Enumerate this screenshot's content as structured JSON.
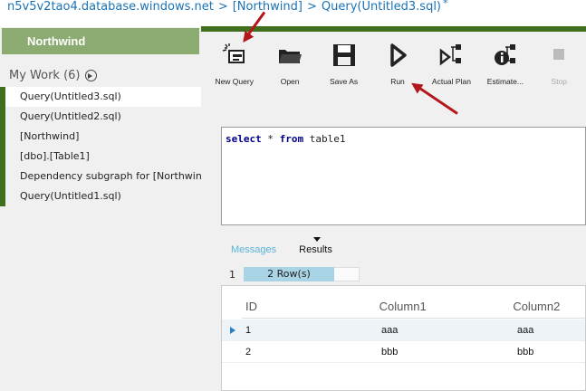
{
  "breadcrumb": {
    "server": "n5v5v2tao4.database.windows.net",
    "sep1": ">",
    "database": "[Northwind]",
    "sep2": ">",
    "query": "Query(Untitled3.sql)",
    "modified": "*"
  },
  "sidebar": {
    "header": "Northwind",
    "mywork": "My Work (6)",
    "items": [
      {
        "label": "Query(Untitled3.sql)"
      },
      {
        "label": "Query(Untitled2.sql)"
      },
      {
        "label": "[Northwind]"
      },
      {
        "label": "[dbo].[Table1]"
      },
      {
        "label": "Dependency subgraph for [Northwind]"
      },
      {
        "label": "Query(Untitled1.sql)"
      }
    ]
  },
  "toolbar": {
    "new_query": "New Query",
    "open": "Open",
    "save_as": "Save As",
    "run": "Run",
    "actual_plan": "Actual Plan",
    "estimate": "Estimate...",
    "stop": "Stop"
  },
  "editor": {
    "kw1": "select",
    "star": "*",
    "kw2": "from",
    "table": "table1"
  },
  "tabs": {
    "messages": "Messages",
    "results": "Results"
  },
  "rowstrip": {
    "page": "1",
    "count": "2 Row(s)"
  },
  "grid": {
    "columns": [
      "ID",
      "Column1",
      "Column2"
    ],
    "rows": [
      [
        "1",
        "aaa",
        "aaa"
      ],
      [
        "2",
        "bbb",
        "bbb"
      ]
    ]
  },
  "colors": {
    "accent_green": "#3f6f1d",
    "header_green": "#8cab70",
    "link_blue": "#1a73b5",
    "annotation_red": "#b3171b"
  }
}
